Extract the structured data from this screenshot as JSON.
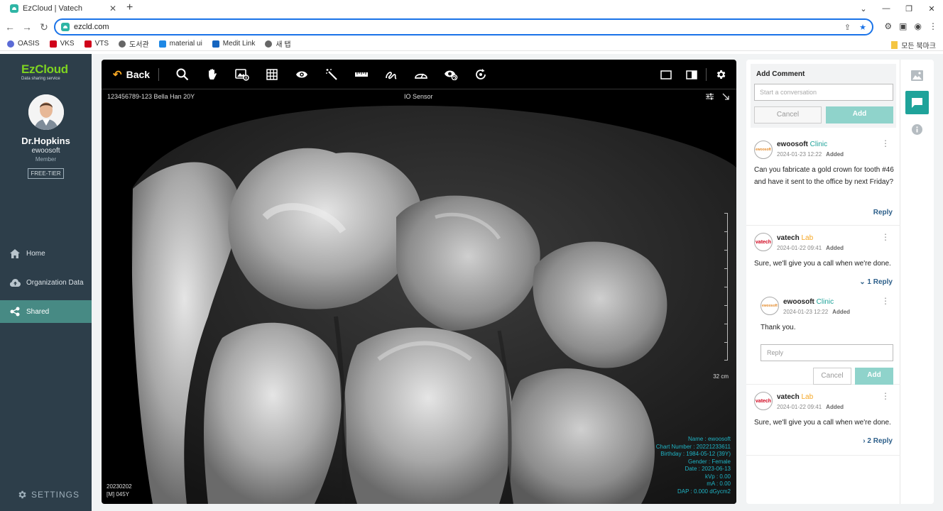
{
  "browser": {
    "tab_title": "EzCloud | Vatech",
    "url": "ezcld.com",
    "bookmarks": [
      "OASIS",
      "VKS",
      "VTS",
      "도서관",
      "material ui",
      "Medit Link",
      "새 탭"
    ],
    "bookmarks_right": "모든 북마크"
  },
  "sidebar": {
    "logo": "EzCloud",
    "logo_sub": "Data sharing service",
    "user_name": "Dr.Hopkins",
    "user_org": "ewoosoft",
    "user_role": "Member",
    "tier": "FREE-TIER",
    "nav": [
      {
        "label": "Home",
        "icon": "home-icon"
      },
      {
        "label": "Organization Data",
        "icon": "cloud-upload-icon"
      },
      {
        "label": "Shared",
        "icon": "share-icon"
      }
    ],
    "active_nav": "Shared",
    "settings": "SETTINGS"
  },
  "viewer": {
    "back": "Back",
    "tools": [
      "search-icon",
      "pan-hand-icon",
      "image-adjust-icon",
      "grid-icon",
      "eye-icon",
      "magic-wand-icon",
      "ruler-icon",
      "freehand-icon",
      "angle-icon",
      "view-rotate-icon",
      "reset-icon"
    ],
    "patient": "123456789-123 Bella Han 20Y",
    "sensor": "IO Sensor",
    "scale_label": "32 cm",
    "meta": [
      "Name : ewoosoft",
      "Chart Number : 20221233611",
      "Birthday : 1984-05-12 (39Y)",
      "Gender : Female",
      "Date : 2023-06-13",
      "kVp : 0.00",
      "mA : 0.00",
      "DAP : 0.000 dGycm2"
    ],
    "date_lines": [
      "20230202",
      "[M] 045Y"
    ]
  },
  "comments": {
    "header": "Add Comment",
    "placeholder": "Start a conversation",
    "cancel": "Cancel",
    "add": "Add",
    "items": [
      {
        "avatar": "ewoosoft",
        "name": "ewoosoft",
        "role": "Clinic",
        "date": "2024-01-23 12:22",
        "status": "Added",
        "text": "Can you fabricate a gold crown for tooth #46 and have it sent to the office by next Friday?",
        "link": "Reply"
      },
      {
        "avatar": "vatech",
        "name": "vatech",
        "role": "Lab",
        "date": "2024-01-22 09:41",
        "status": "Added",
        "text": "Sure, we'll give you a call when we're done.",
        "link": "1 Reply",
        "reply": {
          "avatar": "ewoosoft",
          "name": "ewoosoft",
          "role": "Clinic",
          "date": "2024-01-23 12:22",
          "status": "Added",
          "text": "Thank you.",
          "placeholder": "Reply",
          "cancel": "Cancel",
          "add": "Add"
        }
      },
      {
        "avatar": "vatech",
        "name": "vatech",
        "role": "Lab",
        "date": "2024-01-22 09:41",
        "status": "Added",
        "text": "Sure, we'll give you a call when we're done.",
        "link": "2 Reply"
      }
    ]
  },
  "rail": [
    "image-icon",
    "comment-icon",
    "info-icon"
  ],
  "colors": {
    "accent": "#1fa39a",
    "sidebar": "#2d3e4a",
    "active_nav": "#478a84",
    "back_arrow": "#f5a623",
    "meta_text": "#1fb3c4"
  }
}
